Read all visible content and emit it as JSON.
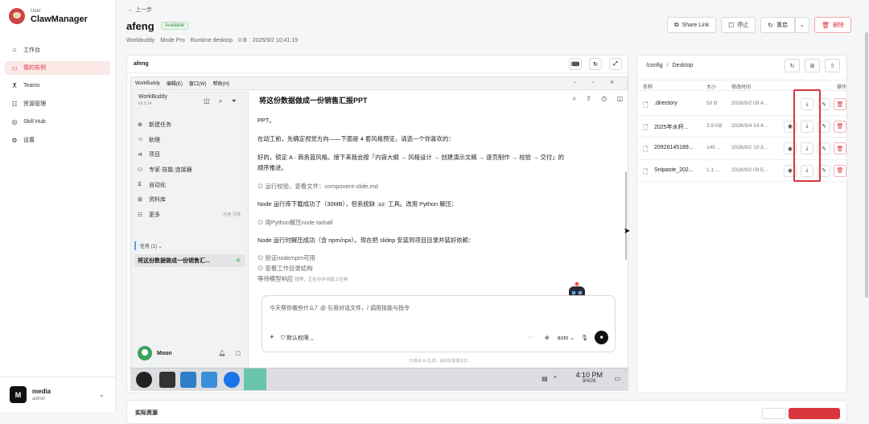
{
  "sidebar": {
    "brand_sub": "User",
    "brand_name": "ClawManager",
    "items": [
      {
        "label": "工作台",
        "icon": "home-icon",
        "glyph": "⌂"
      },
      {
        "label": "我的实例",
        "icon": "monitor-icon",
        "glyph": "▭"
      },
      {
        "label": "Teams",
        "icon": "users-icon",
        "glyph": "ⵅ"
      },
      {
        "label": "资源管理",
        "icon": "sliders-icon",
        "glyph": "☷"
      },
      {
        "label": "Skill Hub",
        "icon": "globe-icon",
        "glyph": "◎"
      },
      {
        "label": "设置",
        "icon": "gear-icon",
        "glyph": "⚙"
      }
    ],
    "active_index": 1,
    "user": {
      "initial": "M",
      "name": "media",
      "role": "admin"
    }
  },
  "header": {
    "back": "← 上一步",
    "title": "afeng",
    "status": "Available",
    "meta": [
      "Workbuddy",
      "Mode Pro",
      "Runtime desktop",
      "0 B",
      "2026/9/2 10:41:19"
    ],
    "actions": [
      {
        "label": "Share Link",
        "icon": "share-icon",
        "glyph": "⧉"
      },
      {
        "label": "停止",
        "icon": "stop-icon",
        "glyph": "☐"
      },
      {
        "label": "重启",
        "icon": "refresh-icon",
        "glyph": "↻"
      },
      {
        "label": "删除",
        "icon": "trash-icon",
        "glyph": "🗑"
      }
    ]
  },
  "terminal": {
    "title": "afeng",
    "desktop": {
      "menubar": [
        "WorkBuddy",
        "编辑(E)",
        "窗口(W)",
        "帮助(H)"
      ],
      "win_controls": [
        "–",
        "▫",
        "✕"
      ],
      "app": {
        "name": "WorkBuddy",
        "version": "v5.3.14",
        "menu": [
          {
            "label": "新建任务",
            "glyph": "⊕"
          },
          {
            "label": "助理",
            "glyph": "☺"
          },
          {
            "label": "项目",
            "glyph": "⊲"
          },
          {
            "label": "专家·技能·连接器",
            "glyph": "⚇"
          },
          {
            "label": "自动化",
            "glyph": "⧖"
          },
          {
            "label": "资料库",
            "glyph": "⊞"
          },
          {
            "label": "更多",
            "glyph": "☷",
            "hint": "应用·灵感"
          }
        ],
        "tasks_header": "任务 (1) ⌄",
        "task": "将这份数据做成一份销售汇...",
        "user": "Moon"
      },
      "chat": {
        "title": "将这份数据做成一份销售汇报PPT",
        "lines": [
          "PPT。",
          "在动工前，先确定视觉方向——下面是 4 套风格预览，请选一个你喜欢的：",
          "好的，锁定 A · 商务蓝风格。接下来我会按「内容大纲 → 风格设计 → 创建演示文稿 → 逐页制作 → 校验 → 交付」的",
          "顺序推进。",
          "运行校验、查看文件：component-slide.md",
          "Node 运行库下载成功了（30MB），但系统缺",
          "xz",
          "工具。改用 Python 解压：",
          "用Python解压node tarball",
          "Node 运行时解压成功（含 npm/npx）。现在把 slidep 安装到项目目录并装好依赖：",
          "验证node/npm可用",
          "查看工作目录结构",
          "等待模型响应",
          "稍等，正在亦步亦趋上狂奔"
        ],
        "input_placeholder": "今天帮你做些什么？@ 引用对话文件，/ 调用技能与指令",
        "permission": "默认权限 ⌄",
        "model": "auto ⌄",
        "disclaimer": "内容由 AI 生成，请核实重要信息"
      },
      "clock": {
        "time": "4:10 PM",
        "date": "9/4/26"
      }
    }
  },
  "files": {
    "path_root": "/config",
    "path_sep": "/",
    "path_dir": "Desktop",
    "columns": [
      "名称",
      "大小",
      "修改时间",
      "操作"
    ],
    "rows": [
      {
        "name": ".directory",
        "size": "50 B",
        "time": "2026/9/2 09:4...",
        "preview": false
      },
      {
        "name": "2025年水杯...",
        "size": "3.9 KB",
        "time": "2026/9/4 14:4...",
        "preview": true
      },
      {
        "name": "20928145189...",
        "size": "145 ...",
        "time": "2026/9/2 10:3...",
        "preview": true
      },
      {
        "name": "Snipaste_202...",
        "size": "1.1 ...",
        "time": "2026/9/2 09:5...",
        "preview": true
      }
    ]
  },
  "bottom": {
    "label": "实际资源"
  },
  "colors": {
    "accent": "#d9363e",
    "available": "#3b8b46"
  }
}
